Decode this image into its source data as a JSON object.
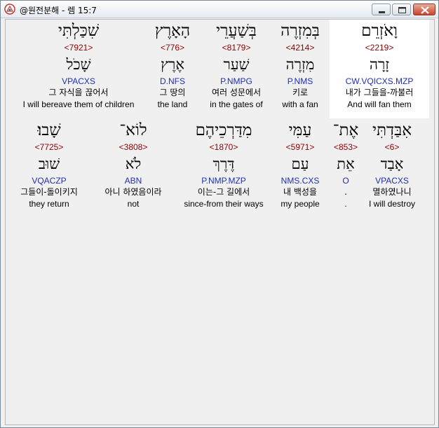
{
  "window": {
    "title": "@원전분해 - 렘 15:7"
  },
  "colors": {
    "strong": "#8b0000",
    "morph": "#1f2fb5",
    "selected_bg": "#ffffff",
    "panel_bg": "#f0f0f0"
  },
  "row1": [
    {
      "hebrew": "וָאֹזְרֵם",
      "strong": "<2219>",
      "lemma": "זָרָה",
      "morph": "CW.VQICXS.MZP",
      "korean": "내가 그들을-까불러",
      "english": "And will fan them",
      "selected": true
    },
    {
      "hebrew": "בְּמִזְרֶה",
      "strong": "<4214>",
      "lemma": "מִזְרֶה",
      "morph": "P.NMS",
      "korean": "키로",
      "english": "with a fan",
      "selected": false
    },
    {
      "hebrew": "בְּשַׁעֲרֵי",
      "strong": "<8179>",
      "lemma": "שַׁעַר",
      "morph": "P.NMPG",
      "korean": "여러 성문에서",
      "english": "in the gates of",
      "selected": false
    },
    {
      "hebrew": "הָאָרֶץ",
      "strong": "<776>",
      "lemma": "אֶרֶץ",
      "morph": "D.NFS",
      "korean": "그 땅의",
      "english": "the land",
      "selected": false
    },
    {
      "hebrew": "שִׁכַּלְתִּי",
      "strong": "<7921>",
      "lemma": "שָׁכֹל",
      "morph": "VPACXS",
      "korean": "그 자식을 끊어서",
      "english": "I will bereave them of children",
      "selected": false
    }
  ],
  "row2": [
    {
      "hebrew": "אִבַּדְתִּי",
      "strong": "<6>",
      "lemma": "אָבַד",
      "morph": "VPACXS",
      "korean": "멸하였나니",
      "english": "I will destroy"
    },
    {
      "hebrew": "אֶת־",
      "strong": "<853>",
      "lemma": "אֵת",
      "morph": "O",
      "korean": ".",
      "english": "."
    },
    {
      "hebrew": "עַמִּי",
      "strong": "<5971>",
      "lemma": "עַם",
      "morph": "NMS.CXS",
      "korean": "내 백성을",
      "english": "my people"
    },
    {
      "hebrew": "מִדַּרְכֵיהֶם",
      "strong": "<1870>",
      "lemma": "דֶּרֶךְ",
      "morph": "P.NMP.MZP",
      "korean": "이는-그 길에서",
      "english": "since-from their ways"
    },
    {
      "hebrew": "לוֹא־",
      "strong": "<3808>",
      "lemma": "לֹא",
      "morph": "ABN",
      "korean": "아니 하였음이라",
      "english": "not"
    },
    {
      "hebrew": "שָׁבוּ׃",
      "strong": "<7725>",
      "lemma": "שׁוּב",
      "morph": "VQACZP",
      "korean": "그들이-돌이키지",
      "english": "they return"
    }
  ]
}
